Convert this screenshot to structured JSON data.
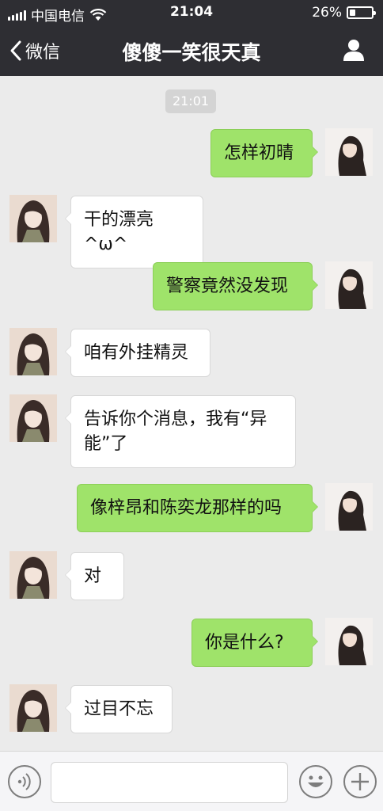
{
  "status": {
    "carrier": "中国电信",
    "time": "21:04",
    "battery": "26%",
    "battery_level": 0.26,
    "signal_icon": "signal-bars-icon",
    "wifi_icon": "wifi-icon"
  },
  "nav": {
    "back_label": "微信",
    "title": "傻傻一笑很天真"
  },
  "chat": {
    "timestamp": "21:01",
    "messages": [
      {
        "side": "out",
        "text": "怎样初晴"
      },
      {
        "side": "in",
        "text": "干的漂亮^ω^"
      },
      {
        "side": "out",
        "text": "警察竟然没发现"
      },
      {
        "side": "in",
        "text": "咱有外挂精灵"
      },
      {
        "side": "in",
        "text": "告诉你个消息，我有“异能”了"
      },
      {
        "side": "out",
        "text": "像梓昂和陈奕龙那样的吗"
      },
      {
        "side": "in",
        "text": "对"
      },
      {
        "side": "out",
        "text": "你是什么?"
      },
      {
        "side": "in",
        "text": "过目不忘"
      }
    ]
  },
  "input": {
    "value": ""
  },
  "colors": {
    "header_bg": "#2e2e33",
    "chat_bg": "#ebebeb",
    "outgoing_bubble": "#9fe36a",
    "incoming_bubble": "#ffffff"
  }
}
